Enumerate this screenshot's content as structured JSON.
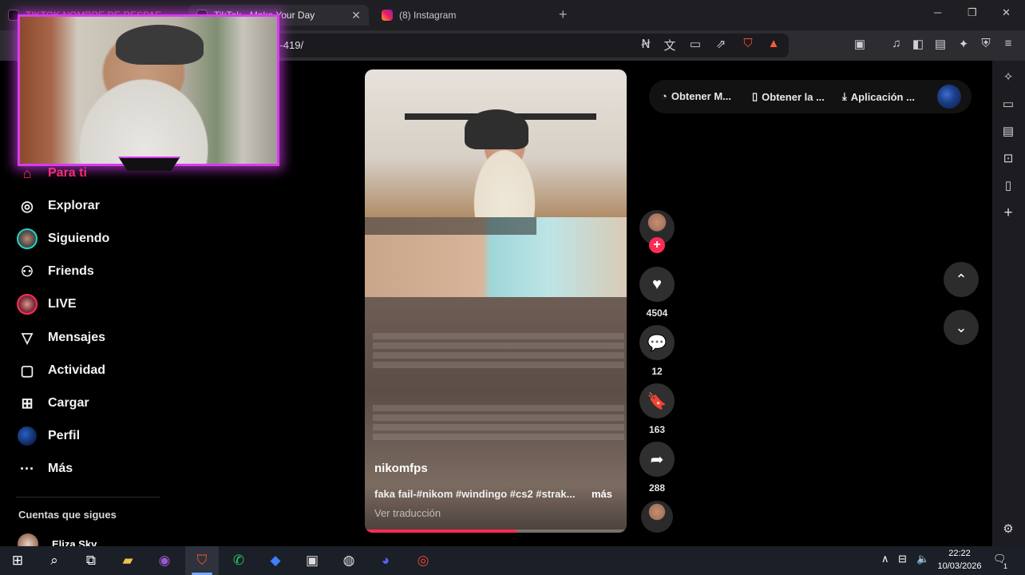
{
  "browser": {
    "tabs": [
      {
        "label": "TIKTOK NOMBRE DE RESPAE",
        "favicon": "tiktok-icon"
      },
      {
        "label": "TikTok - Make Your Day",
        "favicon": "tiktok-icon"
      },
      {
        "label": "(8) Instagram",
        "favicon": "instagram-icon"
      }
    ],
    "new_tab": "+",
    "url": "/...-419/",
    "window_controls": {
      "minimize": "─",
      "maximize": "❐",
      "close": "✕"
    }
  },
  "nav": {
    "items": [
      {
        "label": "Para ti",
        "icon": "home-icon"
      },
      {
        "label": "Explorar",
        "icon": "compass-icon"
      },
      {
        "label": "Siguiendo",
        "icon": "avatar-icon"
      },
      {
        "label": "Friends",
        "icon": "friends-icon"
      },
      {
        "label": "LIVE",
        "icon": "live-icon"
      },
      {
        "label": "Mensajes",
        "icon": "send-icon"
      },
      {
        "label": "Actividad",
        "icon": "message-square-icon"
      },
      {
        "label": "Cargar",
        "icon": "plus-square-icon"
      },
      {
        "label": "Perfil",
        "icon": "profile-avatar-icon"
      },
      {
        "label": "Más",
        "icon": "more-icon"
      }
    ],
    "following_title": "Cuentas que sigues",
    "following": [
      {
        "name": "Eliza Sky"
      }
    ]
  },
  "header": {
    "items": [
      {
        "label": "Obtener M...",
        "icon": "coin-icon"
      },
      {
        "label": "Obtener la ...",
        "icon": "phone-icon"
      },
      {
        "label": "Aplicación ...",
        "icon": "download-icon"
      }
    ]
  },
  "video": {
    "username": "nikomfps",
    "caption": "faka fail-#nikom #windingo #cs2 #strak...",
    "more": "más",
    "translate": "Ver traducción",
    "progress": 0.58
  },
  "actions": {
    "likes": "4504",
    "comments": "12",
    "saves": "163",
    "shares": "288"
  },
  "taskbar": {
    "time": "22:22",
    "date": "10/03/2026",
    "notification_count": "1"
  },
  "colors": {
    "accent": "#fe2c55",
    "overlay_border": "#d63cf0"
  }
}
